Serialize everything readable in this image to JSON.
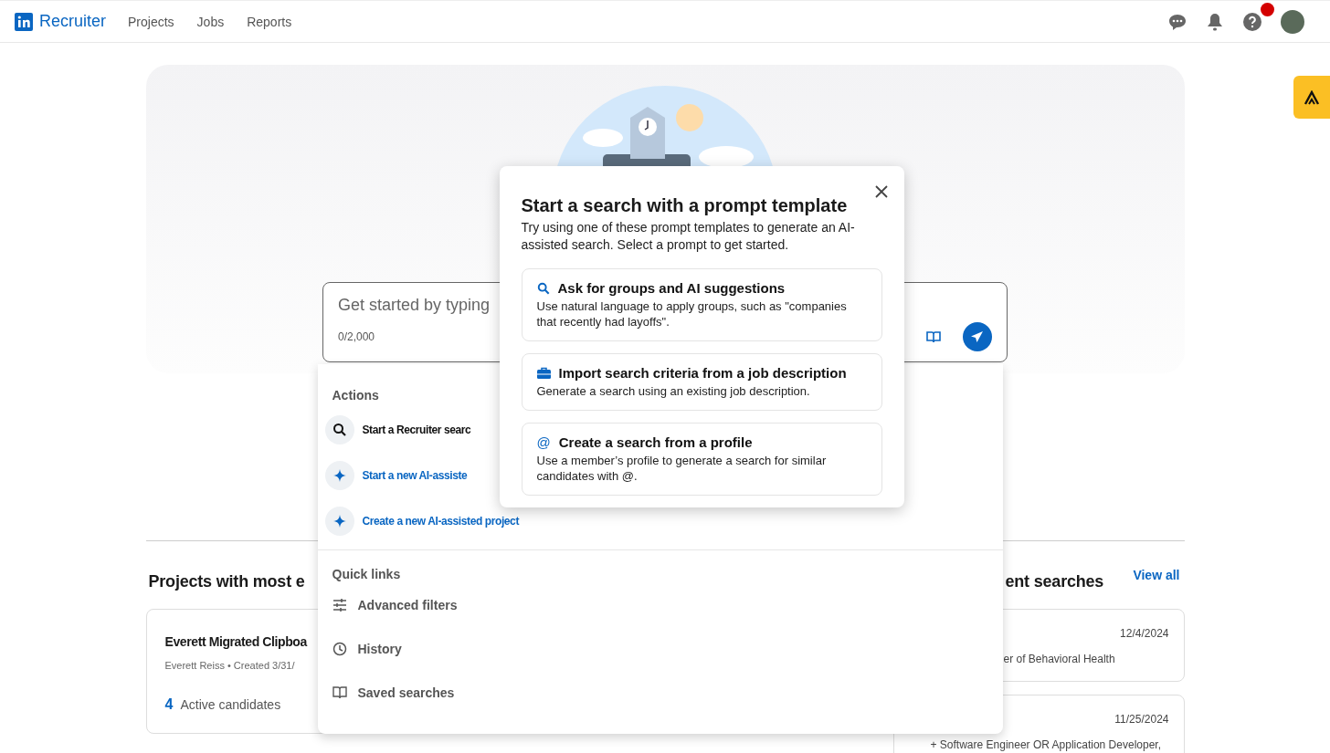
{
  "nav": {
    "brand": "Recruiter",
    "links": [
      {
        "label": "Projects"
      },
      {
        "label": "Jobs"
      },
      {
        "label": "Reports"
      }
    ],
    "help_notification": true
  },
  "search": {
    "placeholder": "Get started by typing",
    "counter": "0/2,000"
  },
  "actions": {
    "heading": "Actions",
    "items": [
      {
        "kind": "search",
        "label": "Start a Recruiter searc"
      },
      {
        "kind": "ai",
        "label": "Start a new AI-assiste"
      },
      {
        "kind": "ai",
        "label": "Create a new AI-assisted project"
      }
    ]
  },
  "quick_links": {
    "heading": "Quick links",
    "items": [
      {
        "kind": "filters",
        "label": "Advanced filters"
      },
      {
        "kind": "history",
        "label": "History"
      },
      {
        "kind": "saved",
        "label": "Saved searches"
      }
    ]
  },
  "prompt_dialog": {
    "title": "Start a search with a prompt template",
    "description": "Try using one of these prompt templates to generate an AI-assisted search. Select a prompt to get started.",
    "templates": [
      {
        "kind": "search",
        "title": "Ask for groups and AI suggestions",
        "description": "Use natural language to apply groups, such as \"companies that recently had layoffs\"."
      },
      {
        "kind": "job",
        "title": "Import search criteria from a job description",
        "description": "Generate a search using an existing job description."
      },
      {
        "kind": "symbol",
        "symbol": "@",
        "title": "Create a search from a profile",
        "description": "Use a member’s profile to generate a search for similar candidates with @."
      }
    ]
  },
  "projects": {
    "heading": "Projects with most e",
    "cards": [
      {
        "title": "Everett Migrated Clipboa",
        "meta": "Everett Reiss • Created 3/31/",
        "count": "4",
        "count_label": "Active candidates"
      }
    ]
  },
  "recent_searches": {
    "heading": "ent searches",
    "view_all": "View all",
    "items": [
      {
        "date": "12/4/2024",
        "text": "er of Behavioral Health"
      },
      {
        "date": "11/25/2024",
        "text": "+ Software Engineer OR Application Developer,"
      }
    ]
  }
}
